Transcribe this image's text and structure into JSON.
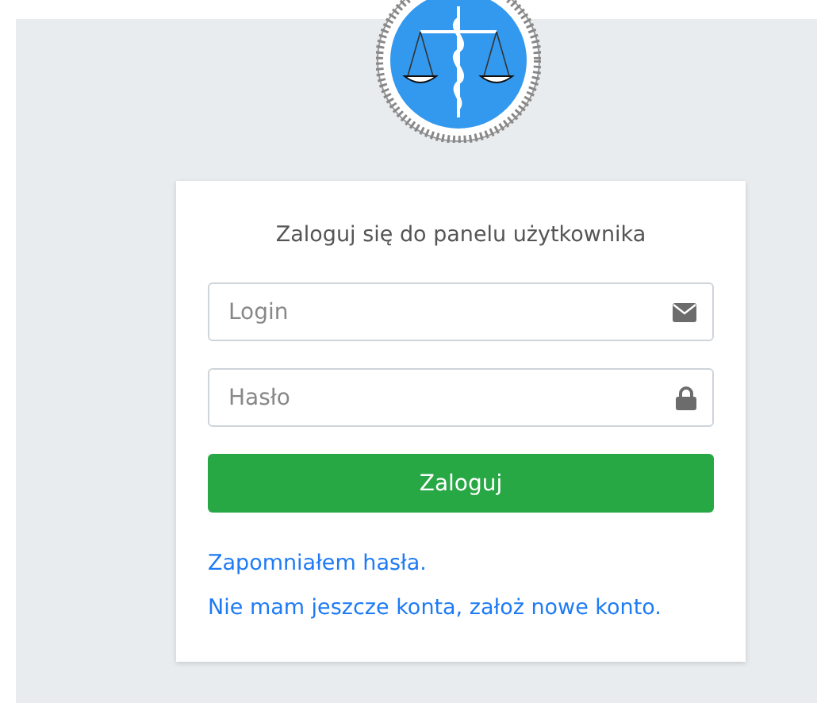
{
  "login_card": {
    "title": "Zaloguj się do panelu użytkownika",
    "fields": [
      {
        "placeholder": "Login",
        "kind": "email"
      },
      {
        "placeholder": "Hasło",
        "kind": "password"
      }
    ],
    "submit": "Zaloguj",
    "links": [
      "Zapomniałem hasła.",
      "Nie mam jeszcze konta, założ nowe konto."
    ]
  }
}
